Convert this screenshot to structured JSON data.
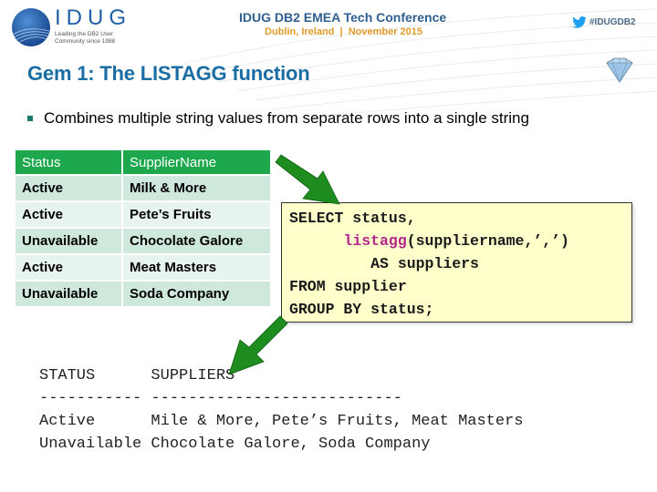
{
  "header": {
    "logo_text": "IDUG",
    "logo_tagline_1": "Leading the DB2 User",
    "logo_tagline_2": "Community since 1988",
    "conference_title": "IDUG DB2 EMEA Tech Conference",
    "conference_subtitle": "Dublin, Ireland  |  November 2015",
    "twitter_hashtag": "#IDUGDB2"
  },
  "slide": {
    "title": "Gem 1: The LISTAGG function",
    "bullet": "Combines multiple string values from separate rows into a single string"
  },
  "table": {
    "headers": [
      "Status",
      "SupplierName"
    ],
    "rows": [
      [
        "Active",
        "Milk & More"
      ],
      [
        "Active",
        "Pete’s Fruits"
      ],
      [
        "Unavailable",
        "Chocolate Galore"
      ],
      [
        "Active",
        "Meat Masters"
      ],
      [
        "Unavailable",
        "Soda Company"
      ]
    ]
  },
  "sql": {
    "line1": "SELECT status,",
    "line2_indent": "      ",
    "line2_fn": "listagg",
    "line2_rest": "(suppliername,’,’)",
    "line3": "         AS suppliers",
    "line4": "FROM supplier",
    "line5": "GROUP BY status;"
  },
  "result": {
    "header": "STATUS      SUPPLIERS",
    "separator": "----------- ---------------------------",
    "rows": [
      "Active      Mile & More, Pete’s Fruits, Meat Masters",
      "Unavailable Chocolate Galore, Soda Company"
    ]
  },
  "colors": {
    "title": "#1b6ea3",
    "table_header": "#1ea84e",
    "row_odd": "#cfe8dc",
    "row_even": "#e7f3ee",
    "sql_bg": "#ffffcc",
    "sql_function": "#b3278b",
    "arrow": "#1e8c1e"
  }
}
